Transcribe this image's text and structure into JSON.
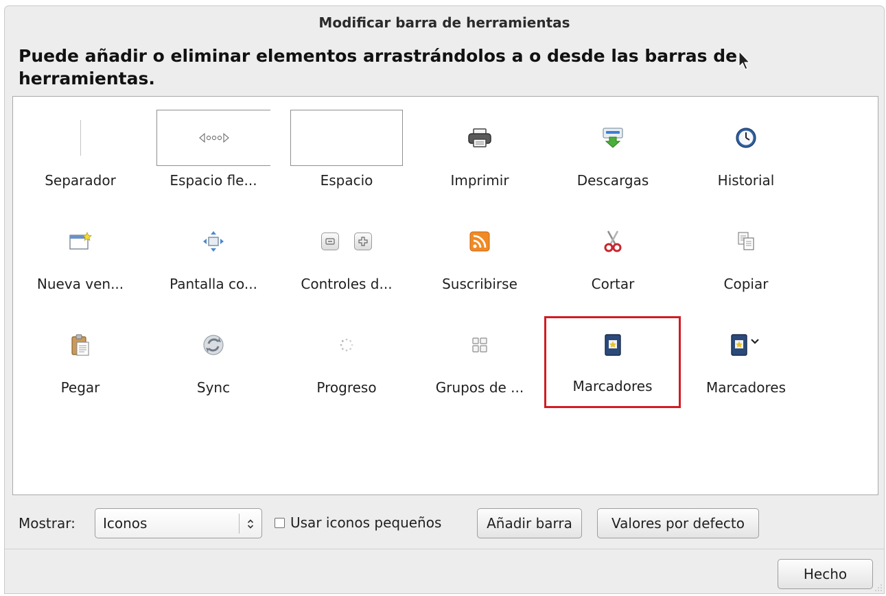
{
  "window": {
    "title": "Modificar barra de herramientas",
    "instructions": "Puede añadir o eliminar elementos arrastrándolos a o desde las barras de herramientas."
  },
  "palette": {
    "items": [
      {
        "label": "Separador",
        "icon": "separator-icon"
      },
      {
        "label": "Espacio fle...",
        "icon": "flexible-space-icon"
      },
      {
        "label": "Espacio",
        "icon": "space-icon"
      },
      {
        "label": "Imprimir",
        "icon": "print-icon"
      },
      {
        "label": "Descargas",
        "icon": "downloads-icon"
      },
      {
        "label": "Historial",
        "icon": "history-clock-icon"
      },
      {
        "label": "Nueva ven...",
        "icon": "new-window-icon"
      },
      {
        "label": "Pantalla co...",
        "icon": "fullscreen-icon"
      },
      {
        "label": "Controles d...",
        "icon": "zoom-controls-icon"
      },
      {
        "label": "Suscribirse",
        "icon": "rss-feed-icon"
      },
      {
        "label": "Cortar",
        "icon": "scissors-icon"
      },
      {
        "label": "Copiar",
        "icon": "copy-icon"
      },
      {
        "label": "Pegar",
        "icon": "clipboard-paste-icon"
      },
      {
        "label": "Sync",
        "icon": "sync-icon"
      },
      {
        "label": "Progreso",
        "icon": "progress-spinner-icon"
      },
      {
        "label": "Grupos de ...",
        "icon": "tab-groups-icon"
      },
      {
        "label": "Marcadores",
        "icon": "bookmarks-icon",
        "selected": true
      },
      {
        "label": "Marcadores",
        "icon": "bookmarks-menu-icon"
      }
    ],
    "selection_color": "#d11c24"
  },
  "controls": {
    "show_label": "Mostrar:",
    "show_select": {
      "value": "Iconos"
    },
    "small_icons_checkbox": {
      "label": "Usar iconos pequeños",
      "checked": false
    },
    "add_toolbar_button": "Añadir barra",
    "defaults_button": "Valores por defecto",
    "done_button": "Hecho"
  }
}
